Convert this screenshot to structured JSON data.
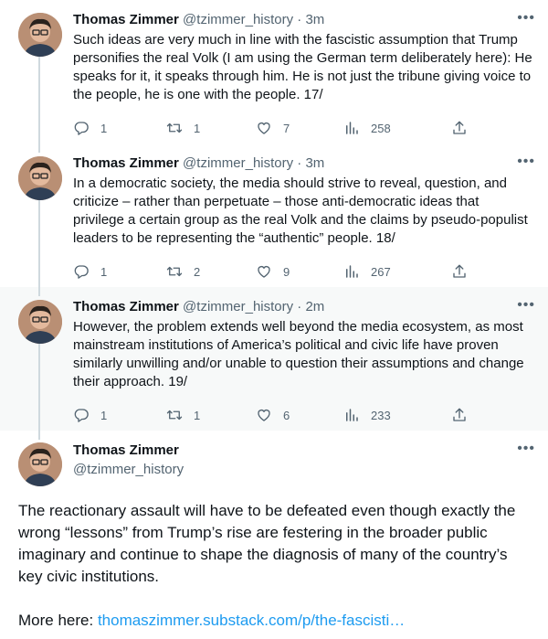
{
  "tweets": [
    {
      "name": "Thomas Zimmer",
      "handle": "@tzimmer_history",
      "dot": "·",
      "time": "3m",
      "text": "Such ideas are very much in line with the fascistic assumption that Trump personifies the real Volk (I am using the German term deliberately here): He speaks for it, it speaks through him. He is not just the tribune giving voice to the people, he is one with the people. 17/",
      "replies": "1",
      "retweets": "1",
      "likes": "7",
      "views": "258"
    },
    {
      "name": "Thomas Zimmer",
      "handle": "@tzimmer_history",
      "dot": "·",
      "time": "3m",
      "text": "In a democratic society, the media should strive to reveal, question, and criticize – rather than perpetuate – those anti-democratic ideas that privilege a certain group as the real Volk and the claims by pseudo-populist leaders to be representing the “authentic” people. 18/",
      "replies": "1",
      "retweets": "2",
      "likes": "9",
      "views": "267"
    },
    {
      "name": "Thomas Zimmer",
      "handle": "@tzimmer_history",
      "dot": "·",
      "time": "2m",
      "text": "However, the problem extends well beyond the media ecosystem, as most mainstream institutions of America’s political and civic life have proven similarly unwilling and/or unable to question their assumptions and change their approach. 19/",
      "replies": "1",
      "retweets": "1",
      "likes": "6",
      "views": "233"
    }
  ],
  "main": {
    "name": "Thomas Zimmer",
    "handle": "@tzimmer_history",
    "text": "The reactionary assault will have to be defeated even though exactly the wrong “lessons” from Trump’s rise are festering in the broader public imaginary and continue to shape the diagnosis of many of the country’s key civic institutions.",
    "more_label": "More here:",
    "link": "thomaszimmer.substack.com/p/the-fascisti…"
  },
  "more_glyph": "•••",
  "colors": {
    "text": "#0f1419",
    "secondary": "#536471",
    "link": "#1d9bf0",
    "thread": "#cfd9de",
    "highlight_bg": "#f7f9f9"
  },
  "icons": [
    "reply-icon",
    "retweet-icon",
    "like-icon",
    "views-icon",
    "share-icon",
    "more-icon"
  ]
}
